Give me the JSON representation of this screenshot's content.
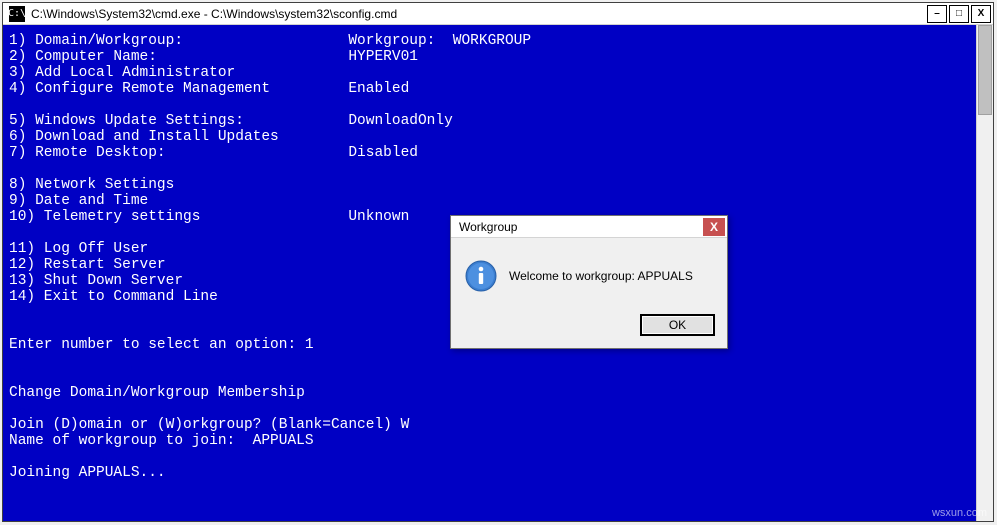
{
  "window": {
    "title": "C:\\Windows\\System32\\cmd.exe - C:\\Windows\\system32\\sconfig.cmd",
    "icon_text": "C:\\"
  },
  "buttons": {
    "minimize": "–",
    "maximize": "□",
    "close": "X"
  },
  "menu": {
    "l1": "1) Domain/Workgroup:                   Workgroup:  WORKGROUP",
    "l2": "2) Computer Name:                      HYPERV01",
    "l3": "3) Add Local Administrator",
    "l4": "4) Configure Remote Management         Enabled",
    "l5": "",
    "l6": "5) Windows Update Settings:            DownloadOnly",
    "l7": "6) Download and Install Updates",
    "l8": "7) Remote Desktop:                     Disabled",
    "l9": "",
    "l10": "8) Network Settings",
    "l11": "9) Date and Time",
    "l12": "10) Telemetry settings                 Unknown",
    "l13": "",
    "l14": "11) Log Off User",
    "l15": "12) Restart Server",
    "l16": "13) Shut Down Server",
    "l17": "14) Exit to Command Line",
    "l18": "",
    "l19": "",
    "l20": "Enter number to select an option: 1",
    "l21": "",
    "l22": "",
    "l23": "Change Domain/Workgroup Membership",
    "l24": "",
    "l25": "Join (D)omain or (W)orkgroup? (Blank=Cancel) W",
    "l26": "Name of workgroup to join:  APPUALS",
    "l27": "",
    "l28": "Joining APPUALS..."
  },
  "dialog": {
    "title": "Workgroup",
    "message": "Welcome to workgroup: APPUALS",
    "ok": "OK",
    "close": "X"
  },
  "watermark": "wsxun.com"
}
